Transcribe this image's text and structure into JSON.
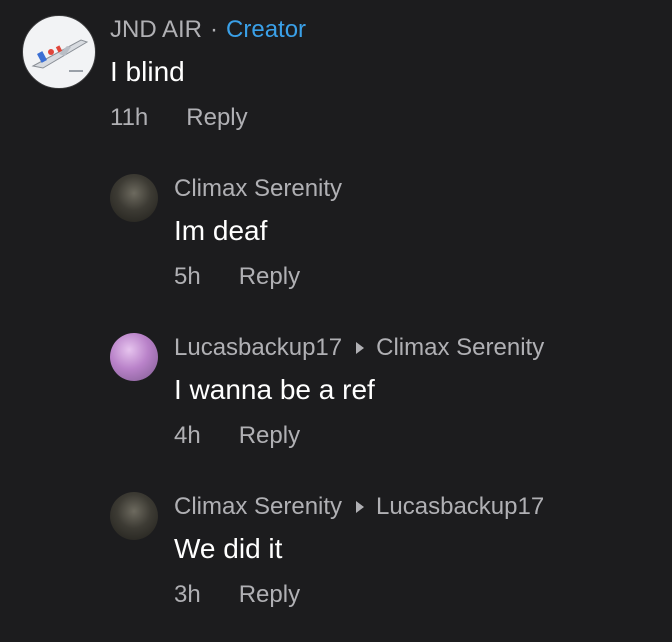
{
  "top_comment": {
    "author": "JND AIR",
    "separator": "·",
    "badge": "Creator",
    "text": "I blind",
    "time": "11h",
    "reply_label": "Reply",
    "avatar_icon": "airplane-avatar-icon"
  },
  "replies": [
    {
      "author": "Climax Serenity",
      "replying_to": "",
      "text": "Im deaf",
      "time": "5h",
      "reply_label": "Reply"
    },
    {
      "author": "Lucasbackup17",
      "replying_to": "Climax Serenity",
      "text": "I wanna be a ref",
      "time": "4h",
      "reply_label": "Reply"
    },
    {
      "author": "Climax Serenity",
      "replying_to": "Lucasbackup17",
      "text": "We did it",
      "time": "3h",
      "reply_label": "Reply"
    }
  ],
  "colors": {
    "background": "#1c1c1e",
    "secondary_text": "#b0b0b4",
    "creator_badge": "#3aa0e8",
    "primary_text": "#ffffff"
  }
}
